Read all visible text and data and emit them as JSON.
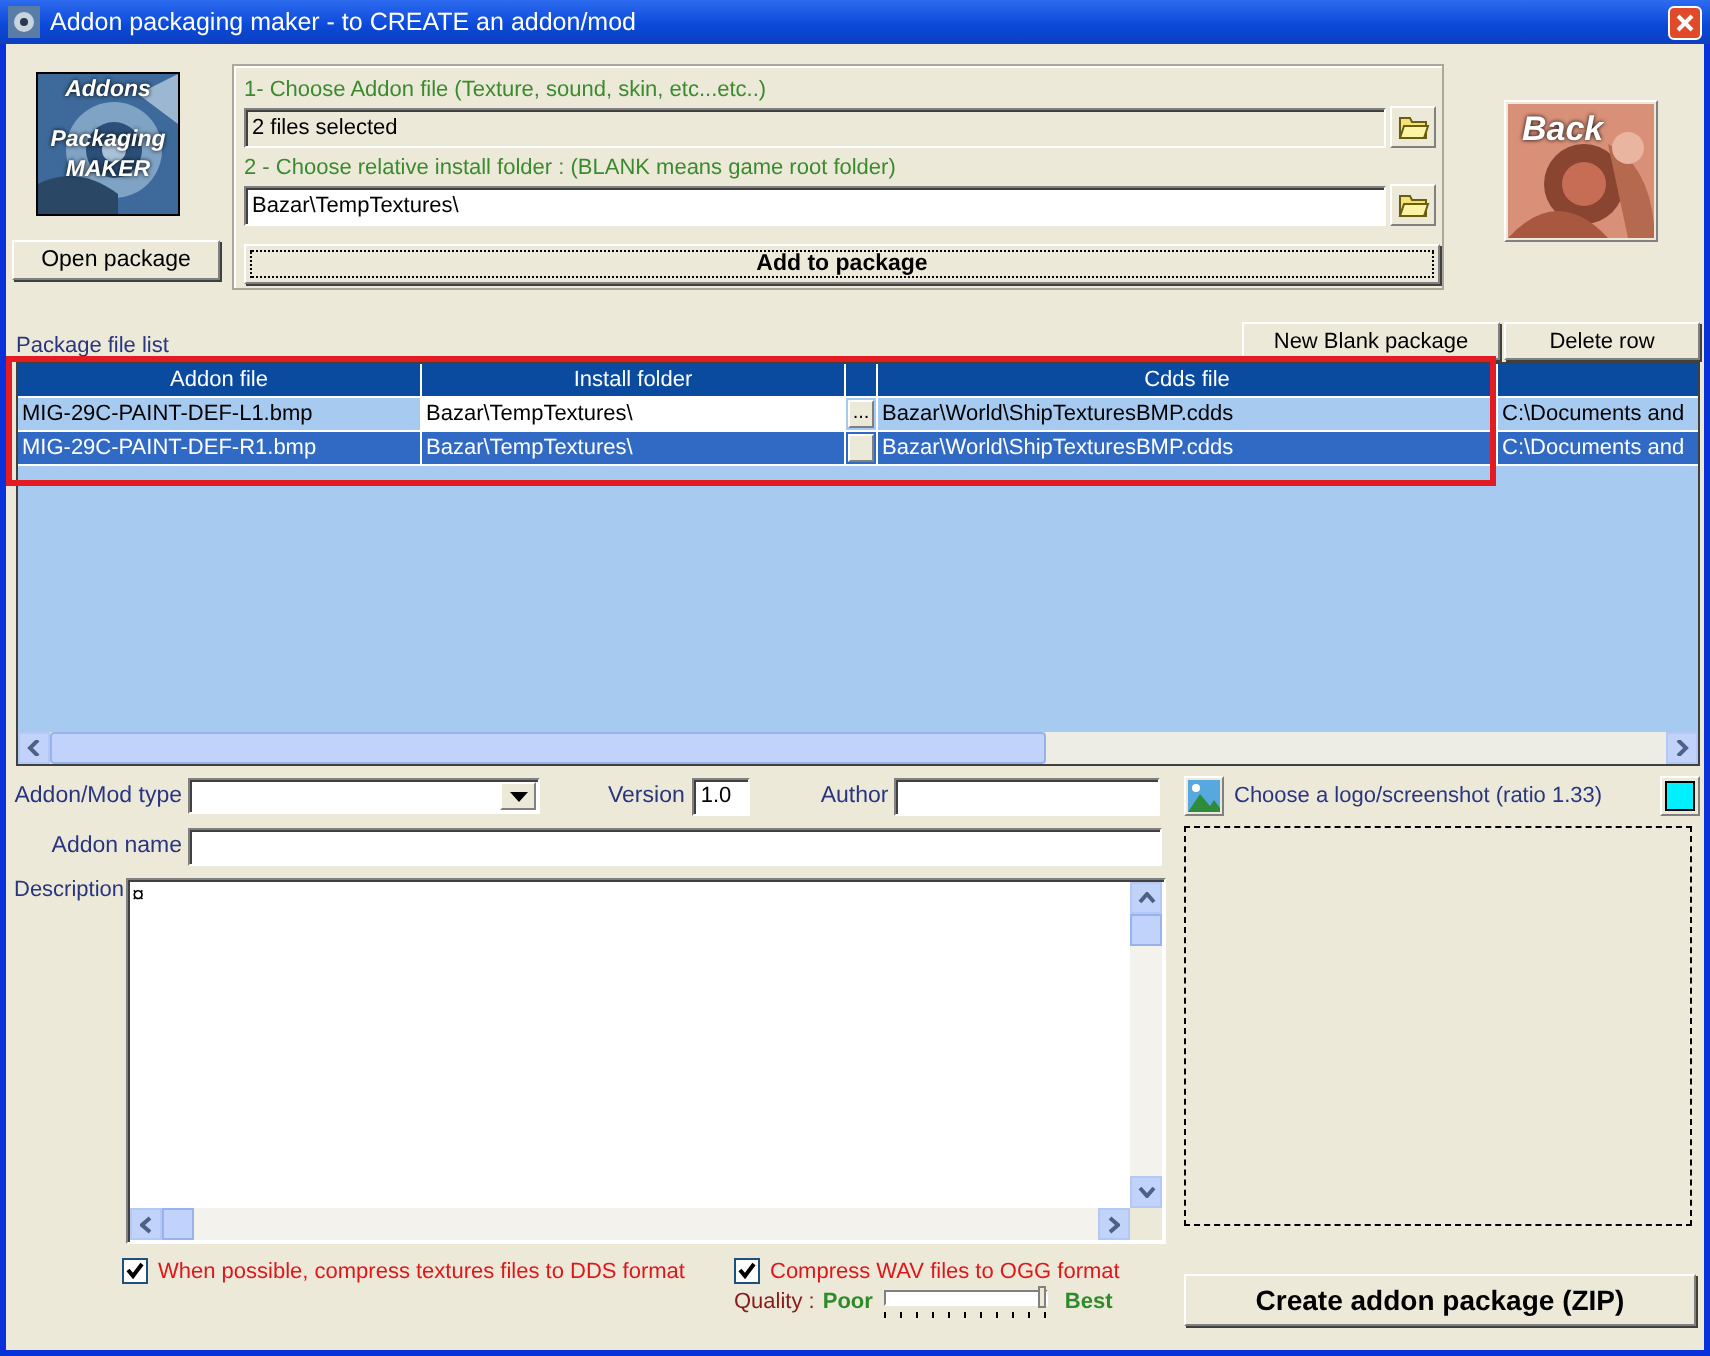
{
  "window": {
    "title": "Addon packaging maker - to CREATE an addon/mod"
  },
  "logo": {
    "lines": [
      "Addons",
      "Packaging",
      "MAKER"
    ]
  },
  "open_button": "Open package",
  "source": {
    "file_label": "1- Choose Addon file (Texture, sound, skin, etc...etc..)",
    "file_value": "2 files selected",
    "folder_label": "2 - Choose relative install folder : (BLANK means game root folder)",
    "folder_value": "Bazar\\TempTextures\\",
    "add_button": "Add to package"
  },
  "back_button": "Back",
  "list_label": "Package file list",
  "list_buttons": [
    "New Blank package",
    "Delete row"
  ],
  "table": {
    "columns": [
      "Addon file",
      "Install folder",
      "",
      "Cdds file",
      ""
    ],
    "rows": [
      {
        "addon_file": "MIG-29C-PAINT-DEF-L1.bmp",
        "install_folder": "Bazar\\TempTextures\\",
        "browse": "...",
        "cdds_file": "Bazar\\World\\ShipTexturesBMP.cdds",
        "column_5": "C:\\Documents and",
        "selected": false,
        "editing": true
      },
      {
        "addon_file": "MIG-29C-PAINT-DEF-R1.bmp",
        "install_folder": "Bazar\\TempTextures\\",
        "browse": "",
        "cdds_file": "Bazar\\World\\ShipTexturesBMP.cdds",
        "column_5": "C:\\Documents and",
        "selected": true,
        "editing": false
      }
    ],
    "highlighted": true
  },
  "form": {
    "type_label": "Addon/Mod type",
    "version_label": "Version",
    "version_value": "1.0",
    "author_label": "Author",
    "name_label": "Addon name",
    "description_label": "Description",
    "description_value": "¤"
  },
  "options": [
    {
      "label": "When possible, compress textures files to DDS format",
      "checked": true
    },
    {
      "label": "Compress WAV files to OGG format",
      "checked": true
    }
  ],
  "quality": {
    "label": "Quality :",
    "low": "Poor",
    "high": "Best",
    "level": 0.97
  },
  "logo_picker": {
    "label": "Choose a logo/screenshot (ratio 1.33)"
  },
  "create_button": "Create addon package (ZIP)"
}
